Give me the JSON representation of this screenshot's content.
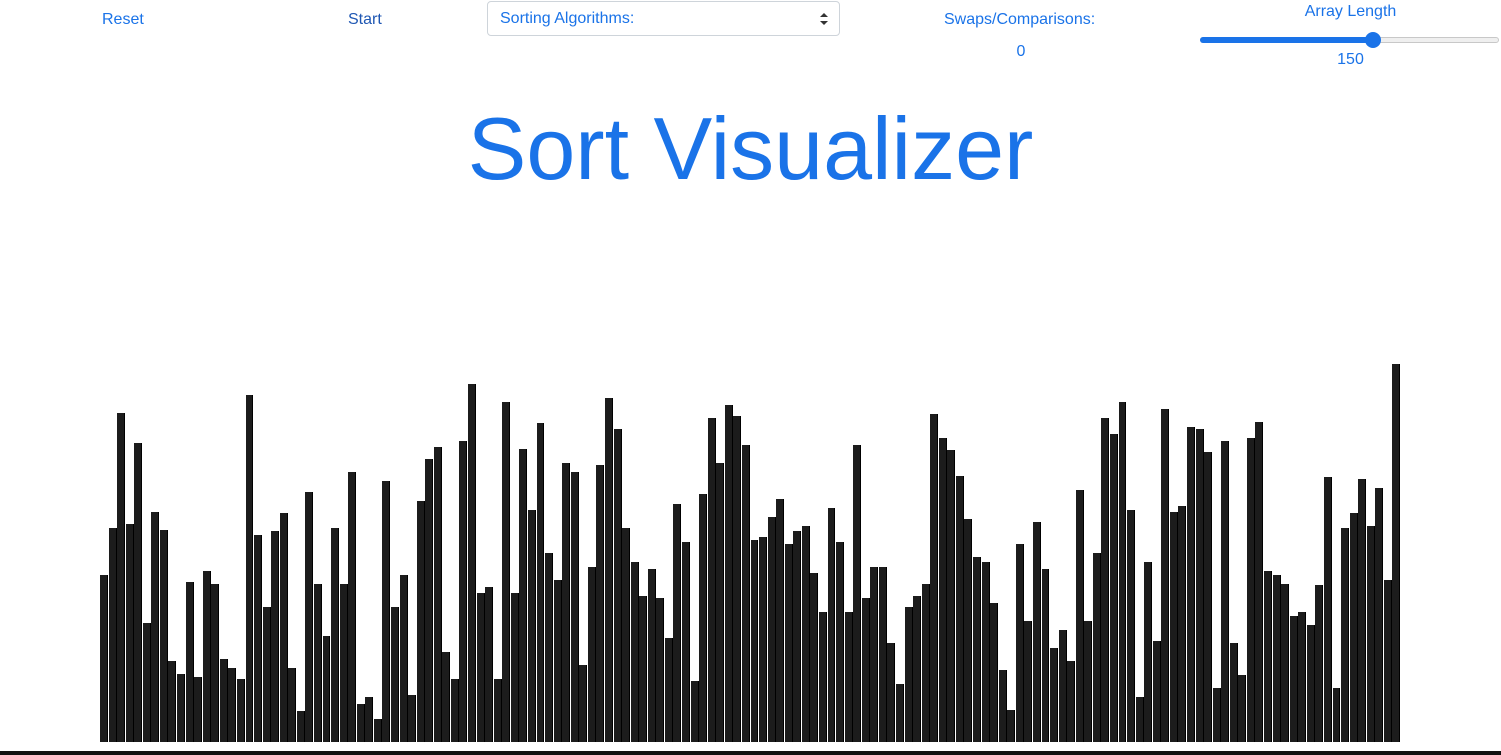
{
  "controls": {
    "reset_label": "Reset",
    "start_label": "Start",
    "algorithm_select": {
      "selected": "Sorting Algorithms:"
    },
    "counter_label": "Swaps/Comparisons:",
    "counter_value": "0",
    "array_length_label": "Array Length",
    "array_length_value": "150",
    "array_length_fraction": 0.58
  },
  "title": "Sort Visualizer",
  "colors": {
    "accent": "#1a73e8",
    "bar": "#1c1c1c",
    "bar_border": "#000000"
  },
  "bars": {
    "max_value": 400,
    "values": [
      186,
      238,
      366,
      242,
      332,
      132,
      256,
      236,
      90,
      76,
      178,
      72,
      190,
      176,
      92,
      82,
      70,
      386,
      230,
      150,
      234,
      254,
      82,
      34,
      278,
      176,
      118,
      238,
      176,
      300,
      42,
      50,
      26,
      290,
      150,
      186,
      52,
      268,
      314,
      328,
      100,
      70,
      334,
      398,
      166,
      172,
      70,
      378,
      166,
      326,
      258,
      354,
      210,
      180,
      310,
      300,
      86,
      194,
      308,
      382,
      348,
      238,
      200,
      162,
      192,
      160,
      116,
      264,
      222,
      68,
      276,
      360,
      310,
      375,
      362,
      330,
      224,
      228,
      250,
      270,
      220,
      234,
      240,
      188,
      144,
      260,
      222,
      144,
      330,
      160,
      195,
      194,
      110,
      65,
      150,
      162,
      176,
      364,
      338,
      324,
      296,
      248,
      206,
      200,
      154,
      80,
      36,
      220,
      134,
      244,
      192,
      104,
      124,
      90,
      280,
      134,
      210,
      360,
      342,
      378,
      258,
      50,
      200,
      112,
      370,
      256,
      262,
      350,
      348,
      322,
      60,
      334,
      110,
      75,
      338,
      356,
      190,
      186,
      176,
      140,
      144,
      130,
      175,
      294,
      60,
      238,
      254,
      292,
      240,
      282,
      180,
      420
    ]
  }
}
